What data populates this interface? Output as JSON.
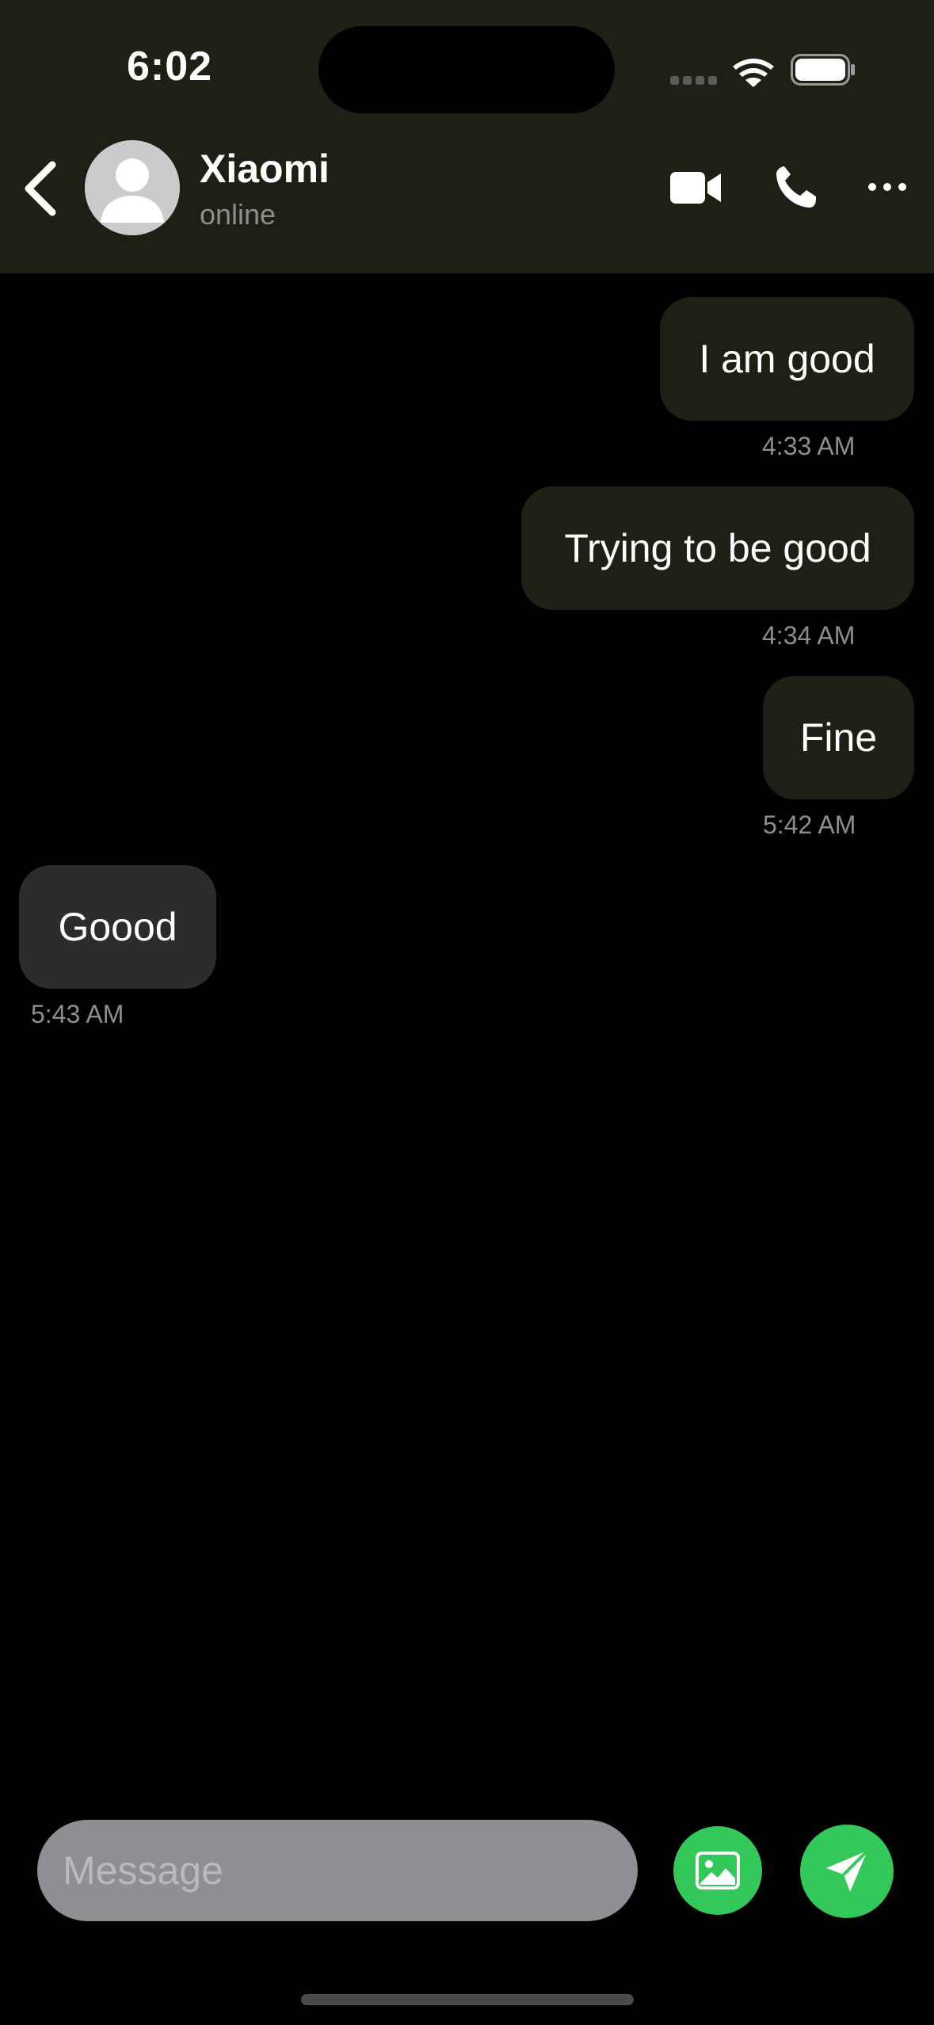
{
  "status_bar": {
    "time": "6:02"
  },
  "header": {
    "contact_name": "Xiaomi",
    "contact_status": "online",
    "icons": [
      "back-chevron-icon",
      "avatar-icon",
      "video-camera-icon",
      "phone-icon",
      "more-dots-icon"
    ]
  },
  "messages": [
    {
      "direction": "sent",
      "text": "I am good",
      "time": "4:33 AM"
    },
    {
      "direction": "sent",
      "text": "Trying to be good",
      "time": "4:34 AM"
    },
    {
      "direction": "sent",
      "text": "Fine",
      "time": "5:42 AM"
    },
    {
      "direction": "received",
      "text": "Goood",
      "time": "5:43 AM"
    }
  ],
  "composer": {
    "placeholder": "Message",
    "value": "",
    "icons": [
      "image-icon",
      "send-icon"
    ]
  },
  "colors": {
    "header_bg": "#201f15",
    "sent_bubble": "#201f15",
    "received_bubble": "#2c2c2e",
    "accent_green": "#34c759",
    "input_bg": "#8e8e93"
  }
}
